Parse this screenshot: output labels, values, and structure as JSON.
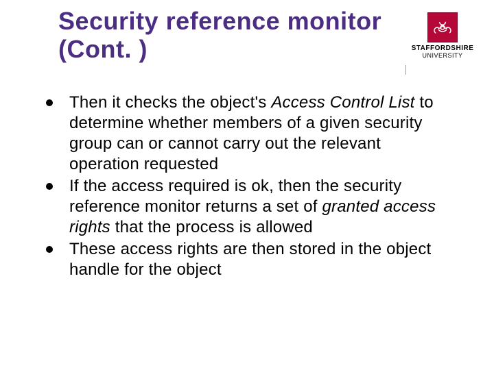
{
  "title": "Security reference monitor (Cont. )",
  "logo": {
    "line1": "STAFFORDSHIRE",
    "line2": "UNIVERSITY"
  },
  "bullets": [
    {
      "pre": "Then it checks the object's ",
      "em": "Access Control List",
      "post": " to determine whether members of a given security group can or cannot carry out the relevant operation requested"
    },
    {
      "pre": "If the access required is ok, then the security reference monitor returns a set of ",
      "em": "granted access rights",
      "post": " that the process is allowed"
    },
    {
      "pre": "These access rights are then stored in the object handle for the object",
      "em": "",
      "post": ""
    }
  ]
}
